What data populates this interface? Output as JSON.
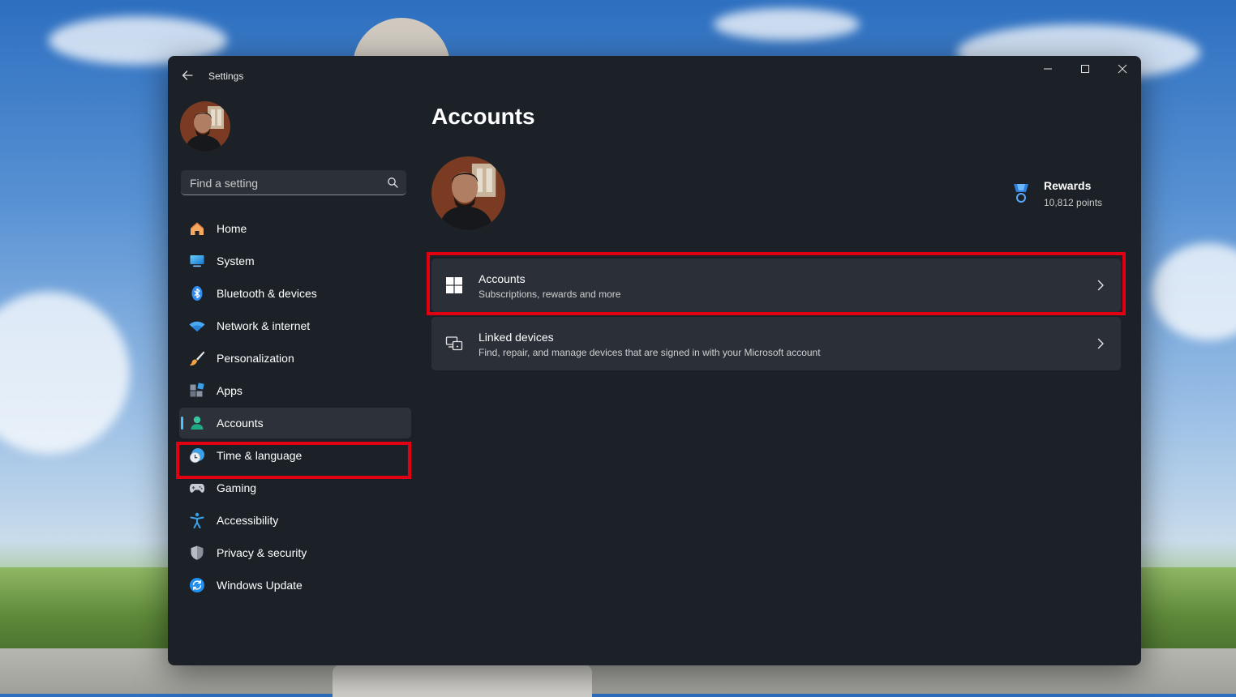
{
  "window": {
    "title": "Settings"
  },
  "search": {
    "placeholder": "Find a setting"
  },
  "nav": {
    "items": [
      {
        "label": "Home",
        "icon": "home-icon"
      },
      {
        "label": "System",
        "icon": "system-icon"
      },
      {
        "label": "Bluetooth & devices",
        "icon": "bluetooth-icon"
      },
      {
        "label": "Network & internet",
        "icon": "wifi-icon"
      },
      {
        "label": "Personalization",
        "icon": "brush-icon"
      },
      {
        "label": "Apps",
        "icon": "apps-icon"
      },
      {
        "label": "Accounts",
        "icon": "person-icon",
        "active": true
      },
      {
        "label": "Time & language",
        "icon": "clock-globe-icon"
      },
      {
        "label": "Gaming",
        "icon": "gamepad-icon"
      },
      {
        "label": "Accessibility",
        "icon": "accessibility-icon"
      },
      {
        "label": "Privacy & security",
        "icon": "shield-icon"
      },
      {
        "label": "Windows Update",
        "icon": "update-icon"
      }
    ]
  },
  "main": {
    "title": "Accounts",
    "rewards": {
      "title": "Rewards",
      "points": "10,812 points"
    },
    "cards": [
      {
        "title": "Accounts",
        "subtitle": "Subscriptions, rewards and more",
        "icon": "windows-logo-icon"
      },
      {
        "title": "Linked devices",
        "subtitle": "Find, repair, and manage devices that are signed in with your Microsoft account",
        "icon": "linked-devices-icon"
      }
    ]
  },
  "colors": {
    "accent": "#4cc2ff",
    "highlight": "#e00012",
    "window_bg": "#1c2128",
    "card_bg": "#2b3038"
  }
}
